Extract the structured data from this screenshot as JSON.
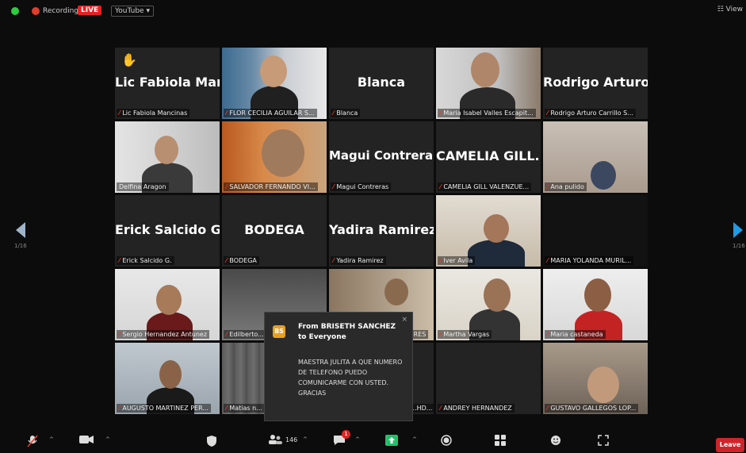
{
  "top": {
    "recording_label": "Recording",
    "live_label": "LIVE",
    "youtube_label": "YouTube ▾",
    "view_label": "View"
  },
  "nav": {
    "prev_page": "1/16",
    "next_page": "1/16"
  },
  "tiles": {
    "t1": {
      "big": "Lic Fabiola Man...",
      "label": "Lic Fabiola Mancinas"
    },
    "t2": {
      "label": "FLOR CECILIA AGUILAR S..."
    },
    "t3": {
      "big": "Blanca",
      "label": "Blanca"
    },
    "t4": {
      "label": "Maria Isabel Valles Escapit..."
    },
    "t5": {
      "big": "Rodrigo Arturo...",
      "label": "Rodrigo Arturo Carrillo S..."
    },
    "t6": {
      "label": "Delfina Aragon"
    },
    "t7": {
      "label": "SALVADOR FERNANDO VI..."
    },
    "t8": {
      "big": "Magui Contreras",
      "label": "Magui Contreras"
    },
    "t9": {
      "big": "CAMELIA GILL...",
      "label": "CAMELIA GILL VALENZUE..."
    },
    "t10": {
      "label": "Ana pulido"
    },
    "t11": {
      "big": "Erick Salcido G.",
      "label": "Erick Salcido G."
    },
    "t12": {
      "big": "BODEGA",
      "label": "BODEGA"
    },
    "t13": {
      "big": "Yadira Ramirez",
      "label": "Yadira Ramirez"
    },
    "t14": {
      "label": "Iver Avila"
    },
    "t15": {
      "label": "MARIA YOLANDA MURIL..."
    },
    "t16": {
      "label": "Sergio Hernandez Antunez"
    },
    "t17": {
      "label": "Edilberto..."
    },
    "t18": {
      "label": "...RES"
    },
    "t19": {
      "label": "Martha Vargas"
    },
    "t20": {
      "label": "Maria castaneda"
    },
    "t21": {
      "label": "AUGUSTO MARTINEZ PER..."
    },
    "t22": {
      "label": "Matias n..."
    },
    "t23": {
      "label": "...HD..."
    },
    "t24": {
      "label": "ANDREY HERNANDEZ"
    },
    "t25": {
      "label": "GUSTAVO GALLEGOS LOP..."
    }
  },
  "chat": {
    "avatar": "BS",
    "from": "From BRISETH SANCHEZ to Everyone",
    "message": "MAESTRA JULITA A QUE NUMERO DE TELEFONO PUEDO COMUNICARME CON USTED. GRACIAS",
    "close": "×"
  },
  "toolbar": {
    "participants_count": "146",
    "chat_badge": "1",
    "leave_label": "Leave"
  },
  "colors": {
    "mic_muted": "#e23c2b",
    "active_speaker": "#b8d24b",
    "leave": "#d0242b"
  }
}
